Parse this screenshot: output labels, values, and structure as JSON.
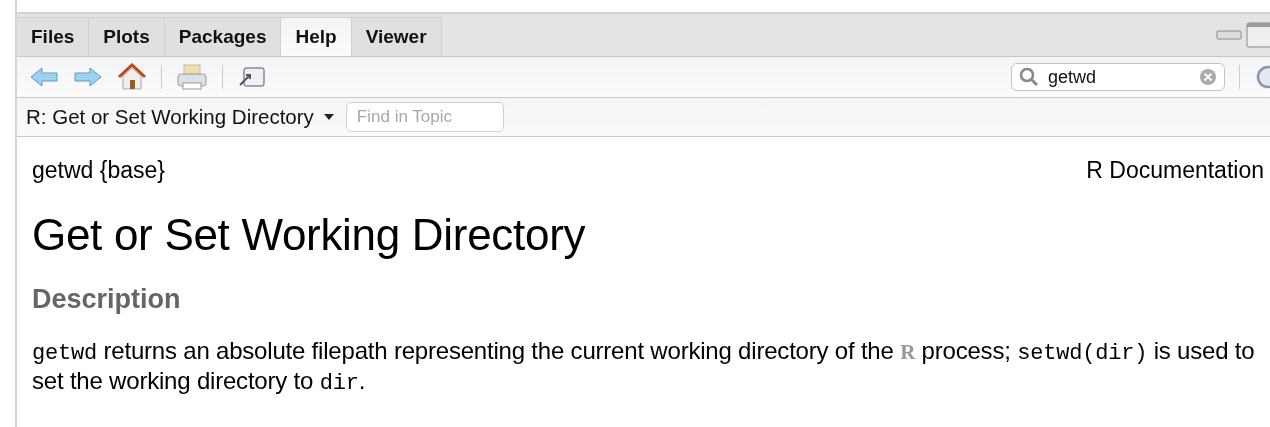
{
  "tabs": [
    {
      "label": "Files",
      "selected": false
    },
    {
      "label": "Plots",
      "selected": false
    },
    {
      "label": "Packages",
      "selected": false
    },
    {
      "label": "Help",
      "selected": true
    },
    {
      "label": "Viewer",
      "selected": false
    }
  ],
  "search": {
    "value": "getwd"
  },
  "topic": {
    "title": "R: Get or Set Working Directory",
    "find_placeholder": "Find in Topic"
  },
  "doc": {
    "package": "getwd {base}",
    "source": "R Documentation",
    "title": "Get or Set Working Directory",
    "section": "Description",
    "paragraph": [
      {
        "kind": "code",
        "text": "getwd"
      },
      {
        "kind": "text",
        "text": " returns an absolute filepath representing the current working directory of the "
      },
      {
        "kind": "rlogo",
        "text": "R"
      },
      {
        "kind": "text",
        "text": " process; "
      },
      {
        "kind": "code",
        "text": "setwd(dir)"
      },
      {
        "kind": "text",
        "text": " is used to set the working directory to "
      },
      {
        "kind": "code",
        "text": "dir"
      },
      {
        "kind": "text",
        "text": "."
      }
    ]
  }
}
